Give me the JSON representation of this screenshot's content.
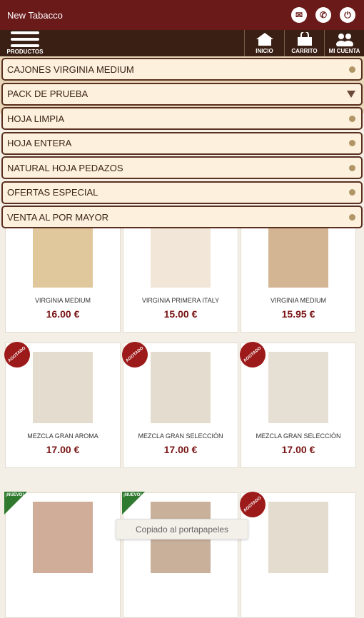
{
  "app": {
    "title": "New Tabacco"
  },
  "header_icons": [
    "mail-icon",
    "phone-icon",
    "power-icon"
  ],
  "nav": {
    "products_label": "PRODUCTOS",
    "buttons": [
      {
        "label": "INICIO",
        "icon": "home-icon"
      },
      {
        "label": "CARRITO",
        "icon": "cart-icon"
      },
      {
        "label": "MI CUENTA",
        "icon": "users-icon"
      }
    ]
  },
  "menu": {
    "items": [
      {
        "label": "CAJONES VIRGINIA MEDIUM",
        "indicator": "dot"
      },
      {
        "label": "PACK DE PRUEBA",
        "indicator": "triangle"
      },
      {
        "label": "HOJA LIMPIA",
        "indicator": "dot"
      },
      {
        "label": "HOJA ENTERA",
        "indicator": "dot"
      },
      {
        "label": "NATURAL HOJA PEDAZOS",
        "indicator": "dot"
      },
      {
        "label": "OFERTAS ESPECIAL",
        "indicator": "dot"
      },
      {
        "label": "VENTA AL POR MAYOR",
        "indicator": "dot"
      }
    ]
  },
  "products": [
    {
      "name": "VIRGINIA MEDIUM",
      "price": "16.00 €",
      "badge": ""
    },
    {
      "name": "VIRGINIA PRIMERA ITALY",
      "price": "15.00 €",
      "badge": ""
    },
    {
      "name": "VIRGINIA MEDIUM",
      "price": "15.95 €",
      "badge": ""
    },
    {
      "name": "MEZCLA GRAN AROMA",
      "price": "17.00 €",
      "badge": "AGOTADO"
    },
    {
      "name": "MEZCLA GRAN SELECCIÓN",
      "price": "17.00 €",
      "badge": "AGOTADO"
    },
    {
      "name": "MEZCLA GRAN SELECCIÓN",
      "price": "17.00 €",
      "badge": "AGOTADO"
    },
    {
      "name": "",
      "price": "",
      "badge": "¡NUEVO!"
    },
    {
      "name": "",
      "price": "",
      "badge": "¡NUEVO!"
    },
    {
      "name": "",
      "price": "",
      "badge": "AGOTADO"
    }
  ],
  "toast": {
    "text": "Copiado al portapapeles"
  },
  "colors": {
    "header": "#6b1a1a",
    "nav": "#3a1f14",
    "menu_bg": "#fdf0dc",
    "price": "#7a1414",
    "badge_sold": "#9d1a1a",
    "badge_new": "#2f7a2f"
  }
}
